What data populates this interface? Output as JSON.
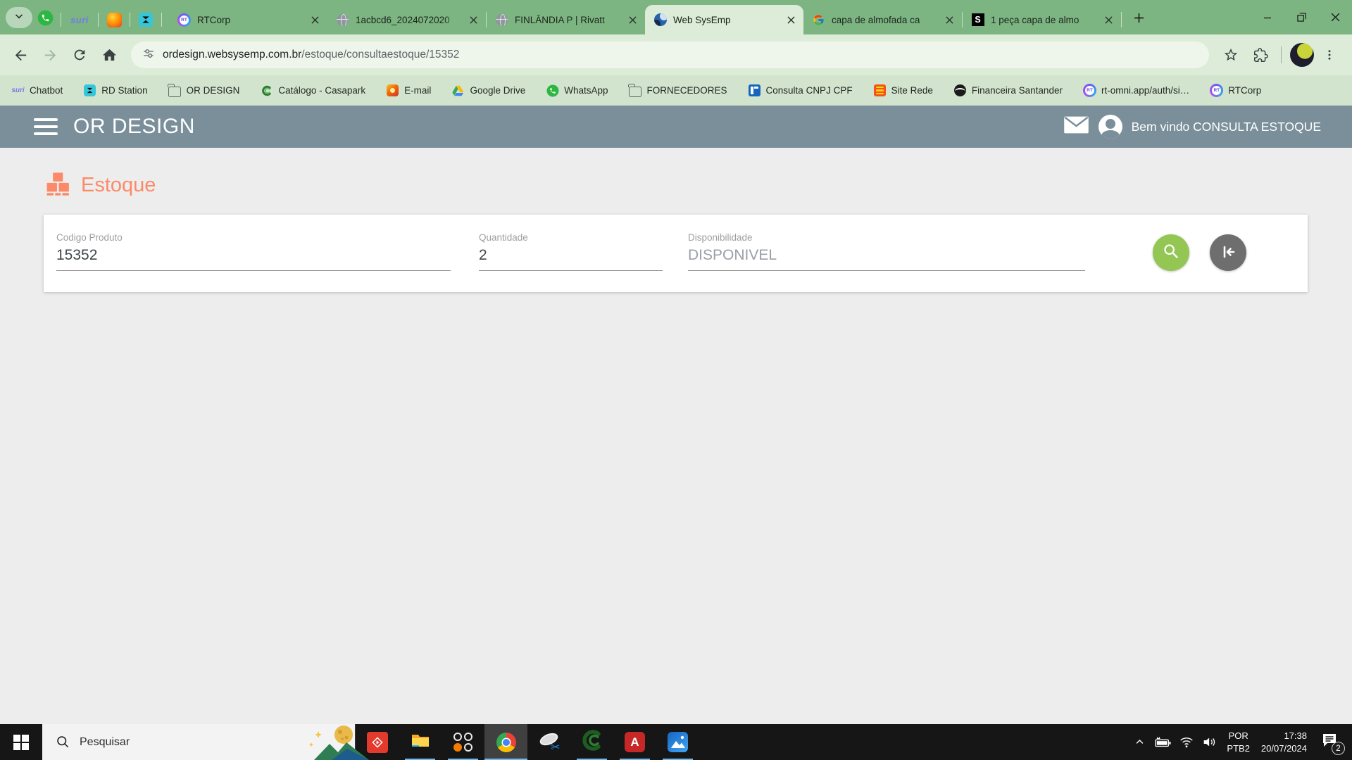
{
  "colors": {
    "frame_green": "#7cb581",
    "toolbar_green": "#dcecd8",
    "bookmarks_green": "#d2e4ce",
    "url_pill": "#eef6ec",
    "header_slate": "#7a8f9a",
    "accent_coral": "#fc8a69",
    "search_button_green": "#94c653",
    "exit_button_gray": "#6e6e6e",
    "content_bg": "#ededed",
    "taskbar_black": "#161616",
    "taskbar_underline_blue": "#76b9ed"
  },
  "icons": {
    "tab-search": "chevron-down",
    "tab-close": "x",
    "new-tab": "plus",
    "minimize": "dash",
    "maximize": "overlapping-squares",
    "window-close": "x",
    "back": "arrow-left",
    "forward": "arrow-right",
    "reload": "circular-arrow",
    "home": "house",
    "site-info": "sliders",
    "bookmark-star": "star-outline",
    "extensions": "puzzle-piece",
    "browser-menu": "three-dots-vertical",
    "app-menu": "hamburger",
    "mail": "envelope",
    "user": "person-circle",
    "stock": "stacked-boxes-pallet",
    "search": "magnifier",
    "exit": "arrow-into-bar",
    "start": "windows-logo",
    "tray-expand": "chevron-up",
    "battery": "battery-charging",
    "network": "wifi",
    "volume": "speaker-waves",
    "notifications": "comment-with-badge"
  },
  "browser": {
    "rt_logo_text": "RT",
    "shein_logo_text": "S",
    "pinned_tabs": [
      {
        "icon": "whatsapp-icon"
      },
      {
        "icon": "suri-icon",
        "text": "suri"
      },
      {
        "icon": "orange-app-icon"
      },
      {
        "icon": "rd-station-icon"
      }
    ],
    "tabs": [
      {
        "label": "RTCorp",
        "icon": "rtcorp-icon",
        "active": false
      },
      {
        "label": "1acbcd6_2024072020",
        "icon": "globe-icon",
        "active": false
      },
      {
        "label": "FINLÂNDIA P | Rivatt",
        "icon": "globe-icon",
        "active": false
      },
      {
        "label": "Web SysEmp",
        "icon": "websysemp-icon",
        "active": true
      },
      {
        "label": "capa de almofada ca",
        "icon": "google-icon",
        "active": false
      },
      {
        "label": "1 peça capa de almo",
        "icon": "shein-icon",
        "active": false
      }
    ],
    "address": {
      "domain": "ordesign.websysemp.com.br",
      "path": "/estoque/consultaestoque/15352"
    },
    "bookmarks": [
      {
        "label": "Chatbot",
        "icon": "suri-icon",
        "icon_text": "suri"
      },
      {
        "label": "RD Station",
        "icon": "rd-station-icon"
      },
      {
        "label": "OR DESIGN",
        "icon": "folder-icon"
      },
      {
        "label": "Catálogo - Casapark",
        "icon": "casapark-icon"
      },
      {
        "label": "E-mail",
        "icon": "email-icon"
      },
      {
        "label": "Google Drive",
        "icon": "google-drive-icon"
      },
      {
        "label": "WhatsApp",
        "icon": "whatsapp-icon"
      },
      {
        "label": "FORNECEDORES",
        "icon": "folder-icon"
      },
      {
        "label": "Consulta CNPJ CPF",
        "icon": "cnpj-icon"
      },
      {
        "label": "Site Rede",
        "icon": "site-rede-icon"
      },
      {
        "label": "Financeira Santander",
        "icon": "santander-icon"
      },
      {
        "label": "rt-omni.app/auth/si…",
        "icon": "rtcorp-icon"
      },
      {
        "label": "RTCorp",
        "icon": "rtcorp-icon"
      }
    ]
  },
  "app": {
    "brand": "OR DESIGN",
    "welcome": "Bem vindo CONSULTA ESTOQUE",
    "page_title": "Estoque",
    "form": {
      "fields": [
        {
          "label": "Codigo Produto",
          "value": "15352"
        },
        {
          "label": "Quantidade",
          "value": "2"
        },
        {
          "label": "Disponibilidade",
          "value": "DISPONIVEL"
        }
      ]
    }
  },
  "taskbar": {
    "search_placeholder": "Pesquisar",
    "apps": [
      "remote-app",
      "file-explorer",
      "app-launcher",
      "chrome",
      "snipping-tool",
      "catalog-app",
      "acrobat-reader",
      "photos"
    ],
    "tray": {
      "language_line1": "POR",
      "language_line2": "PTB2",
      "time": "17:38",
      "date": "20/07/2024",
      "notification_count": "2"
    }
  }
}
